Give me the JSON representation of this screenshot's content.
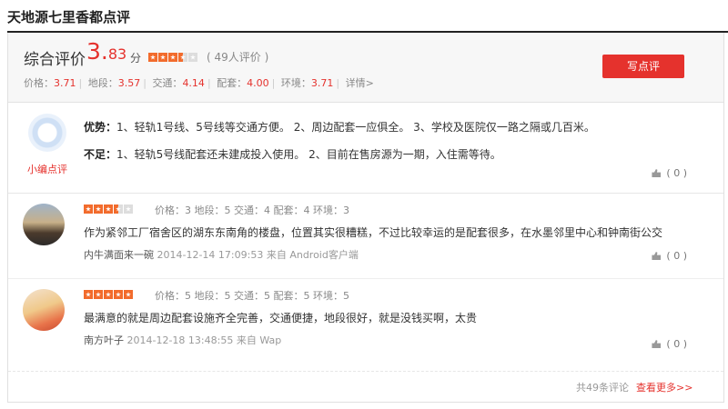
{
  "page_title": "天地源七里香都点评",
  "summary": {
    "label": "综合评价",
    "score_int": "3.",
    "score_dec": "83",
    "unit": "分",
    "count": "( 49人评价 )",
    "stars": 3.5,
    "write_label": "写点评",
    "sub_scores": [
      {
        "label": "价格：",
        "value": "3.71"
      },
      {
        "label": "地段：",
        "value": "3.57"
      },
      {
        "label": "交通：",
        "value": "4.14"
      },
      {
        "label": "配套：",
        "value": "4.00"
      },
      {
        "label": "环境：",
        "value": "3.71"
      }
    ],
    "detail_label": "详情>"
  },
  "editor": {
    "name": "小编点评",
    "pros_label": "优势：",
    "pros_text": "1、轻轨1号线、5号线等交通方便。 2、周边配套一应俱全。 3、学校及医院仅一路之隔或几百米。",
    "cons_label": "不足：",
    "cons_text": "1、轻轨5号线配套还未建成投入使用。 2、目前在售房源为一期，入住需等待。",
    "likes": "( 0 )"
  },
  "reviews": [
    {
      "stars": 3.5,
      "meta": "价格：3  地段：5  交通：4  配套：4  环境：3",
      "text": "作为紧邻工厂宿舍区的湖东东南角的楼盘，位置其实很糟糕，不过比较幸运的是配套很多，在水墨邻里中心和钟南街公交",
      "user": "内牛满面来一碗",
      "time": "2014-12-14 17:09:53 来自 Android客户端",
      "likes": "( 0 )"
    },
    {
      "stars": 5,
      "meta": "价格：5  地段：5  交通：5  配套：5  环境：5",
      "text": "最满意的就是周边配套设施齐全完善，交通便捷，地段很好，就是没钱买啊，太贵",
      "user": "南方叶子",
      "time": "2014-12-18 13:48:55 来自 Wap",
      "likes": "( 0 )"
    }
  ],
  "footer": {
    "total": "共49条评论",
    "more": "查看更多>>"
  }
}
